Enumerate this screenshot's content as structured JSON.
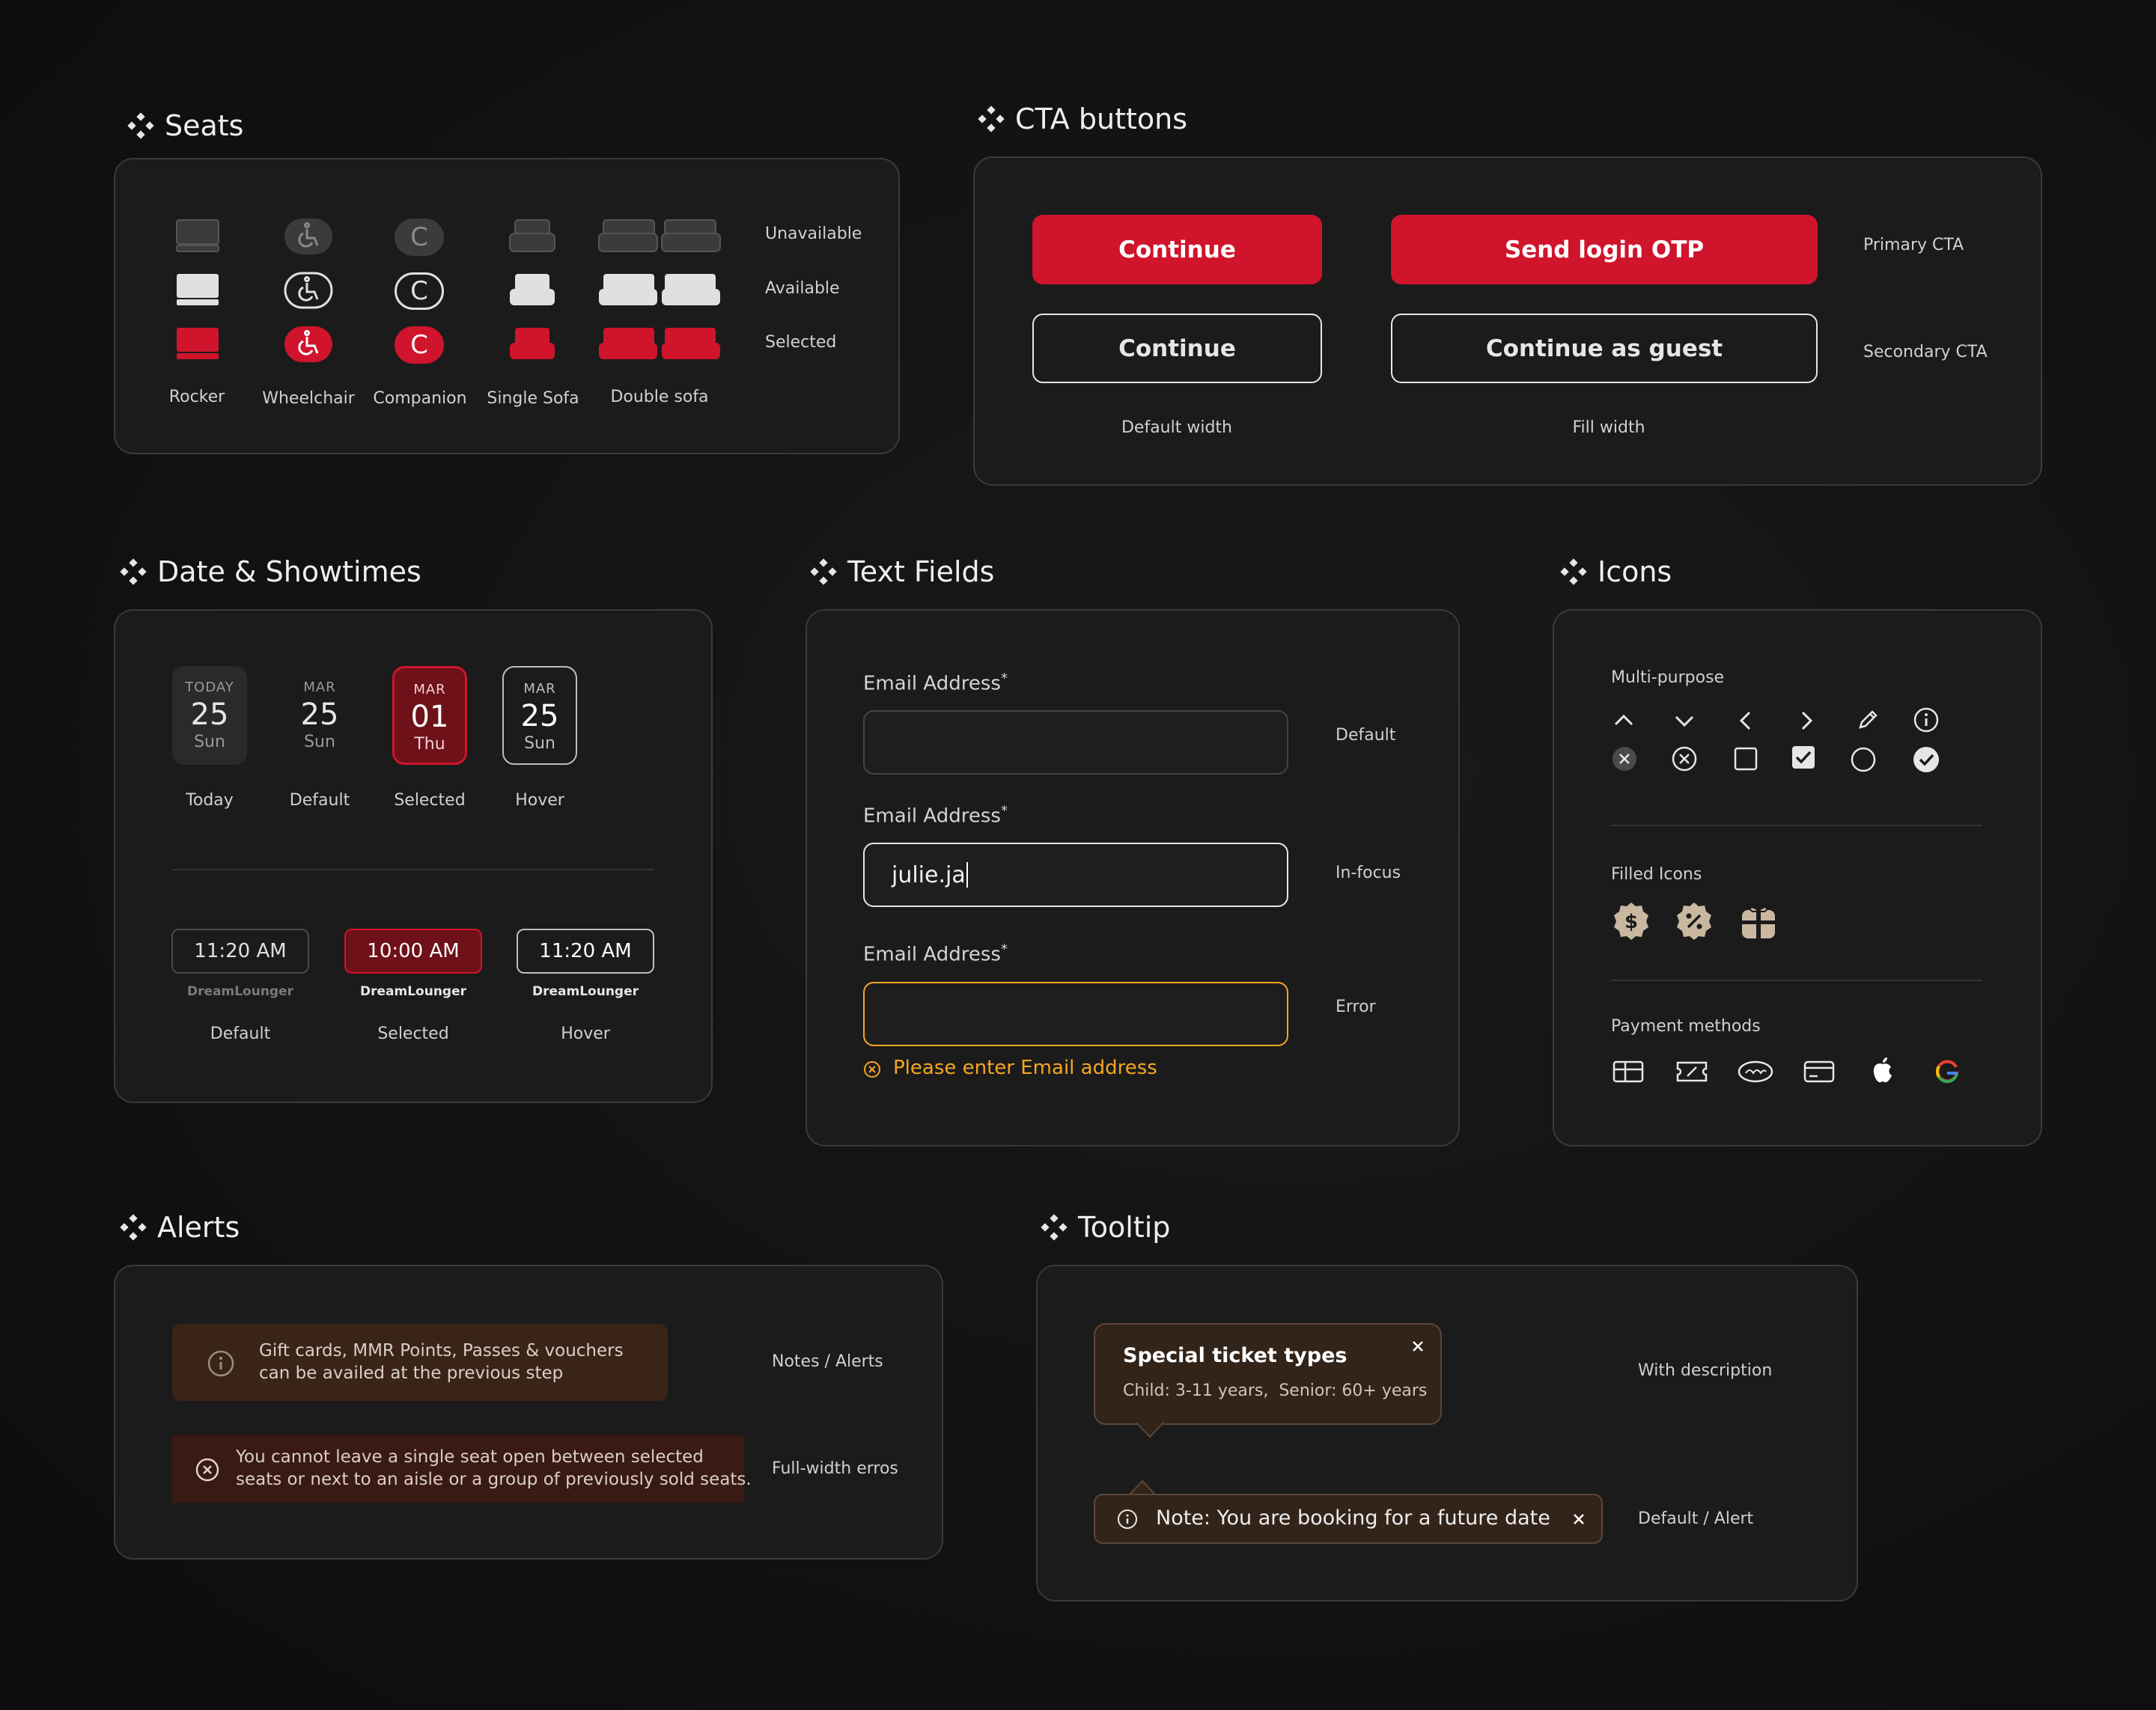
{
  "sections": {
    "seats": "Seats",
    "cta": "CTA buttons",
    "date": "Date & Showtimes",
    "text_fields": "Text Fields",
    "icons": "Icons",
    "alerts": "Alerts",
    "tooltip": "Tooltip"
  },
  "seats": {
    "row_labels": [
      "Unavailable",
      "Available",
      "Selected"
    ],
    "col_labels": [
      "Rocker",
      "Wheelchair",
      "Companion",
      "Single Sofa",
      "Double sofa"
    ],
    "companion_letter": "C",
    "colors": {
      "unavailable": "#3b3b3b",
      "available": "#e0e0e0",
      "selected": "#d0142c"
    }
  },
  "cta": {
    "primary_default": "Continue",
    "primary_fill": "Send login OTP",
    "secondary_default": "Continue",
    "secondary_fill": "Continue as guest",
    "primary_label": "Primary CTA",
    "secondary_label": "Secondary CTA",
    "default_width": "Default width",
    "fill_width": "Fill width",
    "accent": "#d0142c"
  },
  "dates": [
    {
      "month": "TODAY",
      "day": "25",
      "weekday": "Sun",
      "caption": "Today"
    },
    {
      "month": "MAR",
      "day": "25",
      "weekday": "Sun",
      "caption": "Default"
    },
    {
      "month": "MAR",
      "day": "01",
      "weekday": "Thu",
      "caption": "Selected"
    },
    {
      "month": "MAR",
      "day": "25",
      "weekday": "Sun",
      "caption": "Hover"
    }
  ],
  "times": [
    {
      "time": "11:20 AM",
      "format": "DreamLounger",
      "caption": "Default"
    },
    {
      "time": "10:00 AM",
      "format": "DreamLounger",
      "caption": "Selected"
    },
    {
      "time": "11:20 AM",
      "format": "DreamLounger",
      "caption": "Hover"
    }
  ],
  "text_fields": {
    "label": "Email Address",
    "required_mark": "*",
    "focus_value": "julie.ja",
    "error_message": "Please enter Email address",
    "state_labels": [
      "Default",
      "In-focus",
      "Error"
    ],
    "error_color": "#f5a623"
  },
  "icons": {
    "multi_purpose": "Multi-purpose",
    "filled": "Filled Icons",
    "payment": "Payment methods"
  },
  "alerts": {
    "note_line1": "Gift cards, MMR Points, Passes & vouchers",
    "note_line2": "can be availed at the previous step",
    "note_label": "Notes / Alerts",
    "error_line1": "You cannot leave a single seat open between selected",
    "error_line2": "seats or next to an aisle or a group of previously sold seats.",
    "error_label": "Full-width erros"
  },
  "tooltip": {
    "title": "Special ticket types",
    "description": "Child: 3-11 years,  Senior: 60+ years",
    "with_desc_label": "With description",
    "note": "Note: You are booking for a future date",
    "default_label": "Default / Alert"
  }
}
